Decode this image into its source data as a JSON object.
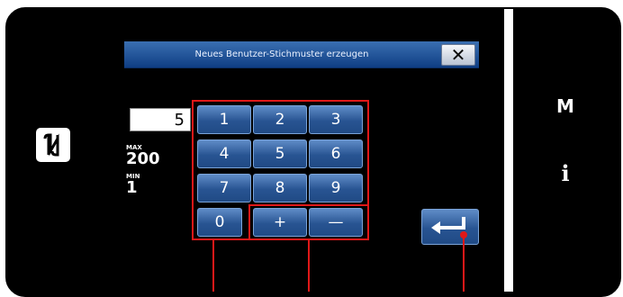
{
  "dialog": {
    "title": "Neues Benutzer-Stichmuster erzeugen",
    "close_label": "✕"
  },
  "input": {
    "value": "5"
  },
  "range": {
    "max_label": "MAX",
    "max_value": "200",
    "min_label": "MIN",
    "min_value": "1"
  },
  "keypad": {
    "keys": [
      "1",
      "2",
      "3",
      "4",
      "5",
      "6",
      "7",
      "8",
      "9",
      "0",
      "+",
      "—"
    ]
  },
  "side": {
    "m_label": "M",
    "info_label": "i"
  },
  "icons": {
    "nfc": "nfc-icon",
    "enter": "enter-arrow-icon",
    "close": "close-icon"
  },
  "colors": {
    "header": "#1a4a8f",
    "key": "#2c5a9a",
    "highlight": "#e01818"
  }
}
